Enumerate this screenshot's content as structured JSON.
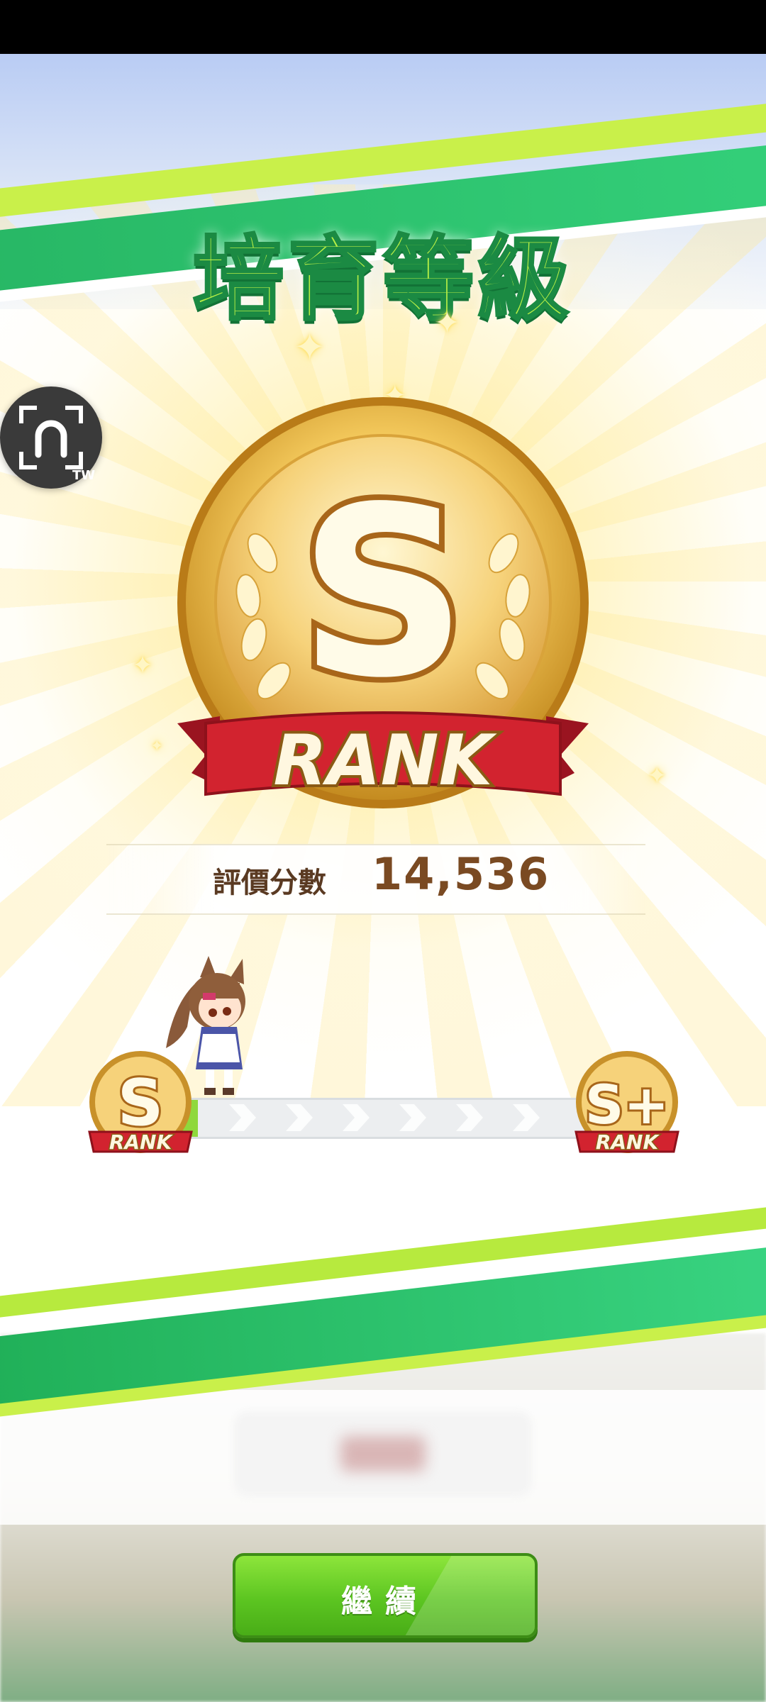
{
  "screen": {
    "title": "培育等級",
    "rank": {
      "letter": "S",
      "label": "RANK"
    },
    "score": {
      "label": "評價分數",
      "value": "14,536"
    },
    "progress": {
      "current_rank": {
        "letter": "S",
        "label": "RANK"
      },
      "next_rank": {
        "letter": "S+",
        "label": "RANK"
      },
      "fraction": 0.06
    },
    "continue_button": {
      "label": "繼續"
    },
    "overlay_button": {
      "icon": "horseshoe-camera-icon",
      "tag": "TW"
    }
  },
  "colors": {
    "green_stripe": "#2fc46d",
    "lime_stripe": "#c9f04a",
    "gold": "#e8b43a",
    "ribbon_red": "#c8202c",
    "button_green": "#5cc521"
  }
}
